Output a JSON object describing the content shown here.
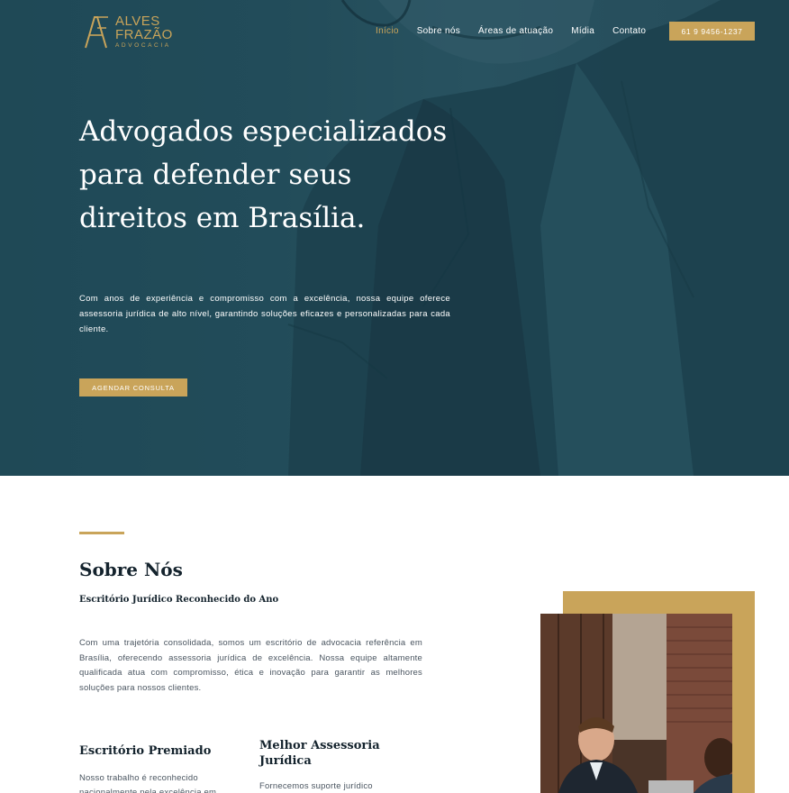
{
  "logo": {
    "line1": "ALVES",
    "line2": "FRAZÃO",
    "line3": "ADVOCACIA",
    "color": "#c9a45a"
  },
  "nav": {
    "items": [
      {
        "label": "Início",
        "active": true
      },
      {
        "label": "Sobre nós",
        "active": false
      },
      {
        "label": "Áreas de atuação",
        "active": false
      },
      {
        "label": "Mídia",
        "active": false
      },
      {
        "label": "Contato",
        "active": false
      }
    ],
    "phone": "61 9 9456-1237"
  },
  "hero": {
    "title": "Advogados especializados para defender seus direitos em Brasília.",
    "text": "Com anos de experiência e compromisso com a excelência, nossa equipe oferece assessoria jurídica de alto nível, garantindo soluções eficazes e personalizadas para cada cliente.",
    "cta": "AGENDAR CONSULTA"
  },
  "about": {
    "title": "Sobre Nós",
    "subtitle": "Escritório Jurídico Reconhecido do Ano",
    "text": "Com uma trajetória consolidada, somos um escritório de advocacia referência em Brasília, oferecendo assessoria jurídica de excelência. Nossa equipe altamente qualificada atua com compromisso, ética e inovação para garantir as melhores soluções para nossos clientes.",
    "features": [
      {
        "title": "Escritório Premiado",
        "text": "Nosso trabalho é reconhecido nacionalmente pela excelência em"
      },
      {
        "title": "Melhor Assessoria Jurídica",
        "text": "Fornecemos suporte jurídico"
      }
    ]
  },
  "colors": {
    "accent": "#c9a45a",
    "hero_bg": "#244f5c",
    "heading": "#14232d"
  }
}
